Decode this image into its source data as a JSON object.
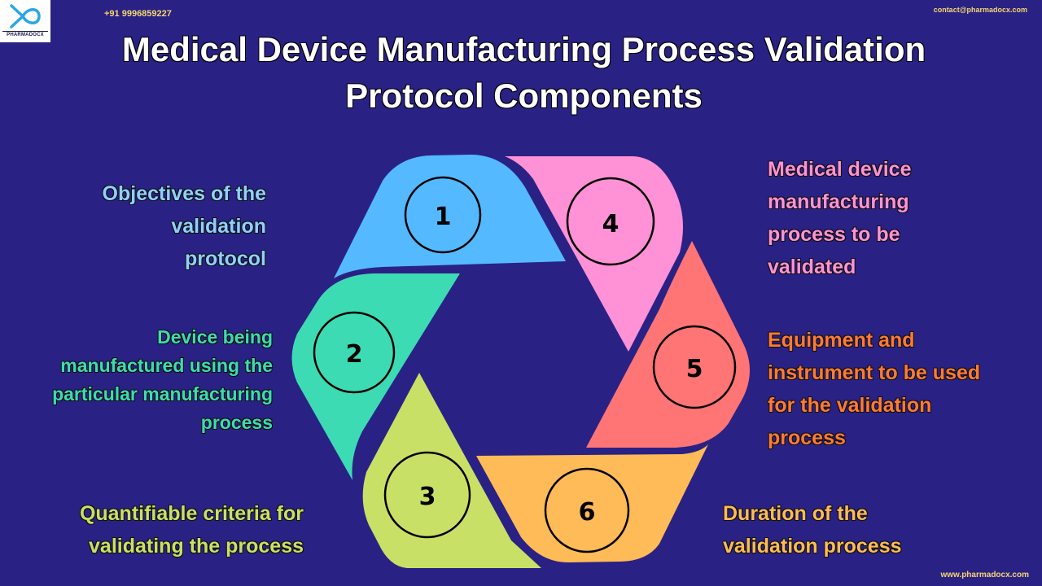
{
  "header": {
    "logo_text": "PHARMADOCX",
    "phone": "+91 9996859227",
    "email": "contact@pharmadocx.com",
    "title_line1": "Medical Device Manufacturing Process Validation",
    "title_line2": "Protocol Components"
  },
  "footer": {
    "website": "www.pharmadocx.com"
  },
  "colors": {
    "background": "#2a2185",
    "title": "#ffffff",
    "contact": "#f5d76e"
  },
  "components": [
    {
      "number": "1",
      "color": "#55b9ff",
      "text_color": "#8fd0ff",
      "lines": [
        "Objectives of the",
        "validation",
        "protocol"
      ]
    },
    {
      "number": "2",
      "color": "#3ddbb4",
      "text_color": "#3ddbb4",
      "lines": [
        "Device being",
        "manufactured using the",
        "particular manufacturing",
        "process"
      ]
    },
    {
      "number": "3",
      "color": "#c9e066",
      "text_color": "#c9e066",
      "lines": [
        "Quantifiable criteria for",
        "validating the process"
      ]
    },
    {
      "number": "4",
      "color": "#ff92d6",
      "text_color": "#ff92d6",
      "lines": [
        "Medical device",
        "manufacturing",
        "process to be",
        "validated"
      ]
    },
    {
      "number": "5",
      "color": "#ff7575",
      "text_color": "#ff7a36",
      "lines": [
        "Equipment and",
        "instrument to be used",
        "for the validation",
        "process"
      ]
    },
    {
      "number": "6",
      "color": "#ffbb57",
      "text_color": "#ffbb57",
      "lines": [
        "Duration of the",
        "validation process"
      ]
    }
  ]
}
